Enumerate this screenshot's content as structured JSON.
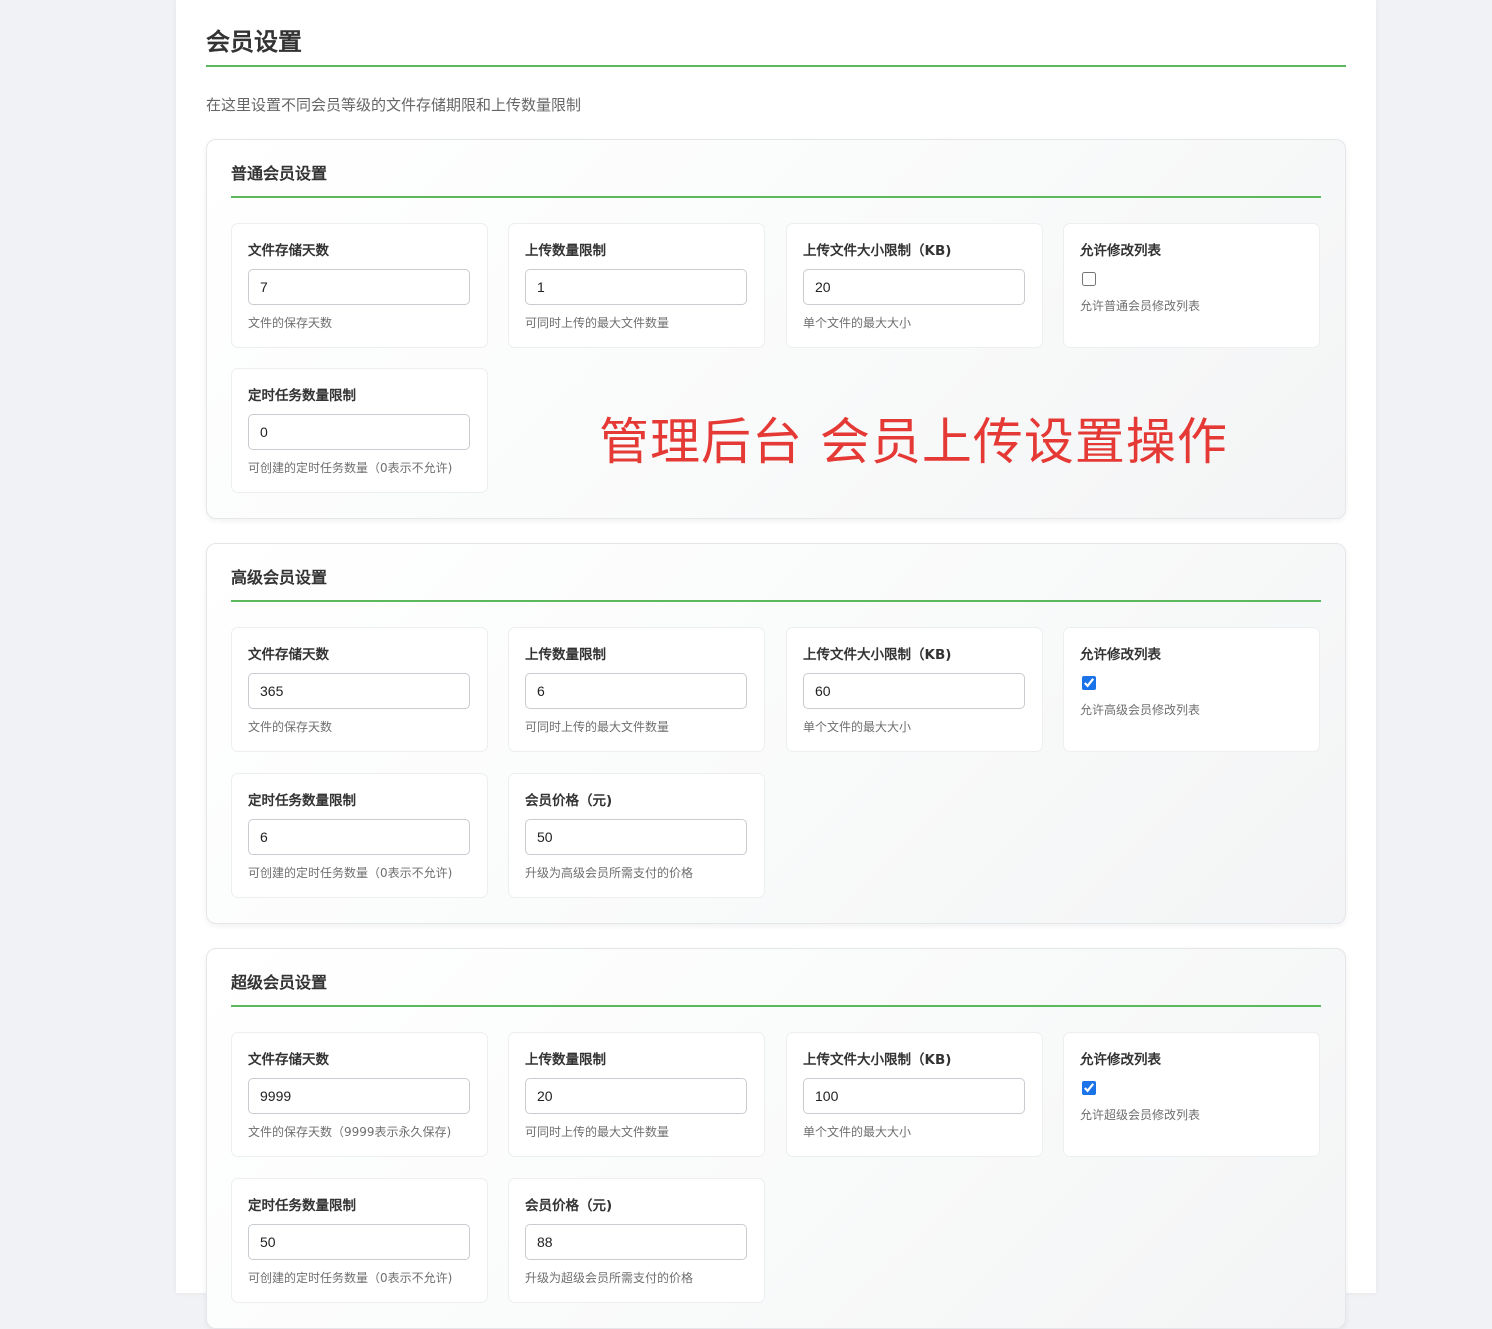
{
  "page": {
    "title": "会员设置",
    "description": "在这里设置不同会员等级的文件存储期限和上传数量限制"
  },
  "overlay_text": "管理后台  会员上传设置操作",
  "sections": [
    {
      "title": "普通会员设置",
      "storage_days": {
        "label": "文件存储天数",
        "value": "7",
        "help": "文件的保存天数"
      },
      "upload_count": {
        "label": "上传数量限制",
        "value": "1",
        "help": "可同时上传的最大文件数量"
      },
      "upload_size": {
        "label": "上传文件大小限制（KB)",
        "value": "20",
        "help": "单个文件的最大大小"
      },
      "allow_edit": {
        "label": "允许修改列表",
        "checked": false,
        "help": "允许普通会员修改列表"
      },
      "task_limit": {
        "label": "定时任务数量限制",
        "value": "0",
        "help": "可创建的定时任务数量（0表示不允许)"
      }
    },
    {
      "title": "高级会员设置",
      "storage_days": {
        "label": "文件存储天数",
        "value": "365",
        "help": "文件的保存天数"
      },
      "upload_count": {
        "label": "上传数量限制",
        "value": "6",
        "help": "可同时上传的最大文件数量"
      },
      "upload_size": {
        "label": "上传文件大小限制（KB)",
        "value": "60",
        "help": "单个文件的最大大小"
      },
      "allow_edit": {
        "label": "允许修改列表",
        "checked": true,
        "help": "允许高级会员修改列表"
      },
      "task_limit": {
        "label": "定时任务数量限制",
        "value": "6",
        "help": "可创建的定时任务数量（0表示不允许)"
      },
      "price": {
        "label": "会员价格（元)",
        "value": "50",
        "help": "升级为高级会员所需支付的价格"
      }
    },
    {
      "title": "超级会员设置",
      "storage_days": {
        "label": "文件存储天数",
        "value": "9999",
        "help": "文件的保存天数（9999表示永久保存)"
      },
      "upload_count": {
        "label": "上传数量限制",
        "value": "20",
        "help": "可同时上传的最大文件数量"
      },
      "upload_size": {
        "label": "上传文件大小限制（KB)",
        "value": "100",
        "help": "单个文件的最大大小"
      },
      "allow_edit": {
        "label": "允许修改列表",
        "checked": true,
        "help": "允许超级会员修改列表"
      },
      "task_limit": {
        "label": "定时任务数量限制",
        "value": "50",
        "help": "可创建的定时任务数量（0表示不允许)"
      },
      "price": {
        "label": "会员价格（元)",
        "value": "88",
        "help": "升级为超级会员所需支付的价格"
      }
    }
  ],
  "colors": {
    "accent_line": "#5cb85c",
    "overlay_text": "#e53935",
    "checkbox": "#1a73e8"
  }
}
